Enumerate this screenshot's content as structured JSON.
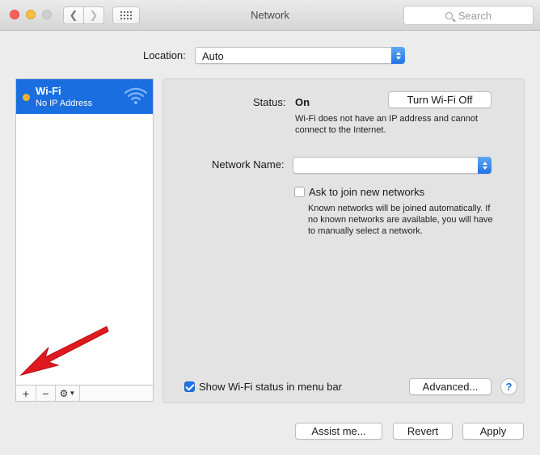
{
  "window": {
    "title": "Network"
  },
  "search": {
    "placeholder": "Search"
  },
  "location": {
    "label": "Location:",
    "value": "Auto"
  },
  "sidebar": {
    "items": [
      {
        "name": "Wi-Fi",
        "status": "No IP Address",
        "status_color": "#f7b32e",
        "icon": "wifi-icon"
      }
    ],
    "toolbar": {
      "add": "+",
      "remove": "−",
      "action_icon": "gear-icon"
    }
  },
  "panel": {
    "status_label": "Status:",
    "status_value": "On",
    "toggle_button": "Turn Wi-Fi Off",
    "status_desc_line1": "Wi-Fi does not have an IP address and cannot",
    "status_desc_line2": "connect to the Internet.",
    "network_name_label": "Network Name:",
    "network_name_value": "",
    "ask_join_label": "Ask to join new networks",
    "ask_join_checked": false,
    "ask_desc_line1": "Known networks will be joined automatically. If",
    "ask_desc_line2": "no known networks are available, you will have",
    "ask_desc_line3": "to manually select a network.",
    "show_status_label": "Show Wi-Fi status in menu bar",
    "show_status_checked": true,
    "advanced_button": "Advanced...",
    "help_button": "?"
  },
  "footer": {
    "assist": "Assist me...",
    "revert": "Revert",
    "apply": "Apply"
  },
  "colors": {
    "accent": "#1b6ee0",
    "annotation_arrow": "#e0191e"
  }
}
